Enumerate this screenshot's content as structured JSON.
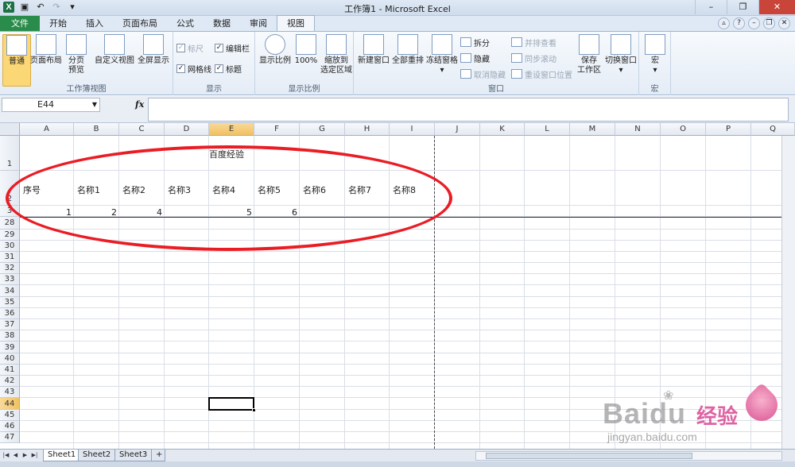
{
  "window": {
    "title": "工作簿1 - Microsoft Excel"
  },
  "tabs": [
    "文件",
    "开始",
    "插入",
    "页面布局",
    "公式",
    "数据",
    "审阅",
    "视图"
  ],
  "ribbon": {
    "workbook_views": {
      "label": "工作簿视图",
      "normal": "普通",
      "page_layout": "页面布局",
      "page_break_line1": "分页",
      "page_break_line2": "预览",
      "custom_views": "自定义视图",
      "full_screen": "全屏显示"
    },
    "show": {
      "label": "显示",
      "ruler": "标尺",
      "gridlines": "网格线",
      "formula_bar": "编辑栏",
      "headings": "标题"
    },
    "zoom": {
      "label": "显示比例",
      "zoom": "显示比例",
      "zoom100": "100%",
      "zoom_sel_line1": "缩放到",
      "zoom_sel_line2": "选定区域"
    },
    "window": {
      "label": "窗口",
      "new_window": "新建窗口",
      "arrange_all": "全部重排",
      "freeze": "冻结窗格",
      "split": "拆分",
      "hide": "隐藏",
      "unhide": "取消隐藏",
      "side_by_side": "并排查看",
      "sync_scroll": "同步滚动",
      "reset_pos": "重设窗口位置",
      "save_ws_line1": "保存",
      "save_ws_line2": "工作区",
      "switch": "切换窗口"
    },
    "macros": {
      "label": "宏",
      "macros": "宏"
    }
  },
  "formula_bar": {
    "name_box": "E44",
    "fx": "fx",
    "content": ""
  },
  "columns": [
    "A",
    "B",
    "C",
    "D",
    "E",
    "F",
    "G",
    "H",
    "I",
    "J",
    "K",
    "L",
    "M",
    "N",
    "O",
    "P",
    "Q"
  ],
  "rows": [
    "1",
    "2",
    "3",
    "28",
    "29",
    "30",
    "31",
    "32",
    "33",
    "34",
    "35",
    "36",
    "37",
    "38",
    "39",
    "40",
    "41",
    "42",
    "43",
    "44",
    "45",
    "46",
    "47"
  ],
  "cells": {
    "title": "百度经验",
    "headers": [
      "序号",
      "名称1",
      "名称2",
      "名称3",
      "名称4",
      "名称5",
      "名称6",
      "名称7",
      "名称8"
    ],
    "row3": [
      "1",
      "2",
      "4",
      "",
      "5",
      "6"
    ]
  },
  "sheets": [
    "Sheet1",
    "Sheet2",
    "Sheet3"
  ],
  "watermark": {
    "brand": "Baidu",
    "cn": "经验",
    "url": "jingyan.baidu.com"
  },
  "colors": {
    "accent": "#2a8c4a",
    "annotation": "#ea1c24",
    "selection": "#f1c15f"
  }
}
